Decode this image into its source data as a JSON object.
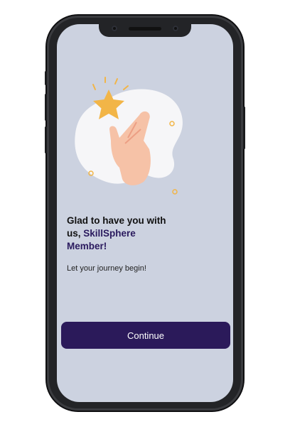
{
  "welcome": {
    "heading_line1": "Glad to have you with",
    "heading_prefix": "us, ",
    "heading_brand": "SkillSphere",
    "heading_member": "Member!",
    "subtext": "Let your journey begin!"
  },
  "actions": {
    "continue_label": "Continue"
  },
  "icons": {
    "illustration": "high-five-hand-with-star-icon"
  },
  "colors": {
    "screen_background": "#ccd2e0",
    "primary_button": "#2b1a5a",
    "brand_text": "#2a1a5e",
    "star": "#f2b547",
    "hand": "#f6c2a7",
    "blob": "#f6f6f8"
  }
}
